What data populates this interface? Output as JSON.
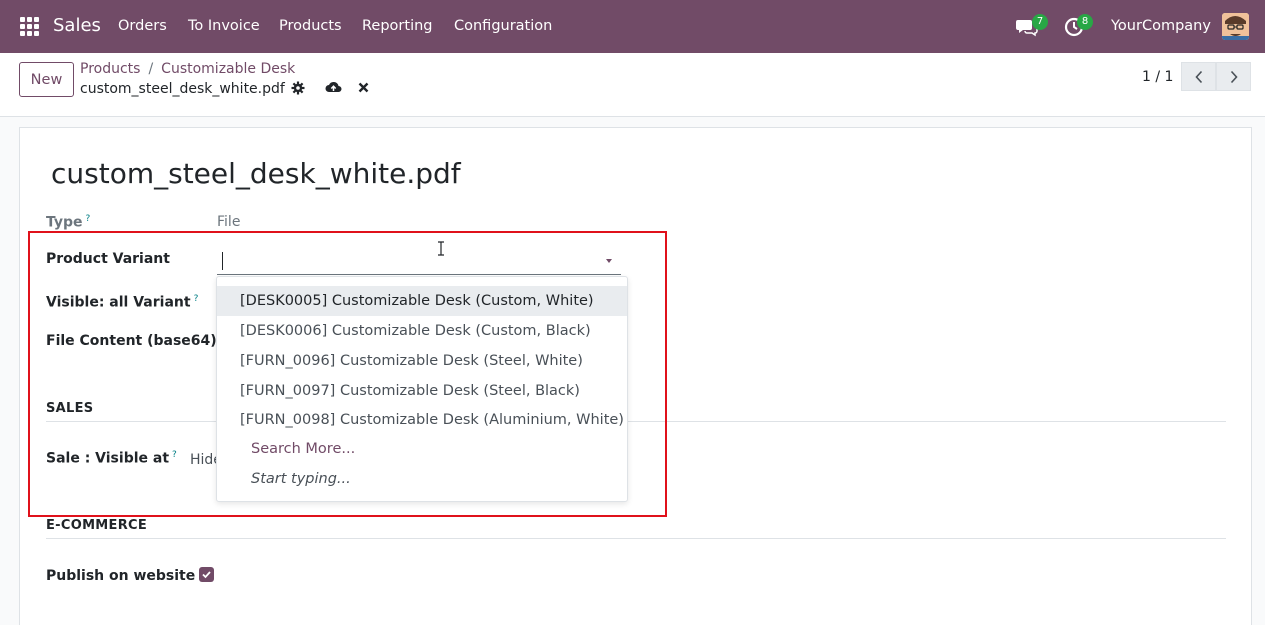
{
  "navbar": {
    "app_name": "Sales",
    "menu": [
      "Orders",
      "To Invoice",
      "Products",
      "Reporting",
      "Configuration"
    ],
    "messages_count": "7",
    "activities_count": "8",
    "company": "YourCompany",
    "color": "#714b67"
  },
  "control_panel": {
    "new_label": "New",
    "breadcrumb": [
      "Products",
      "Customizable Desk"
    ],
    "breadcrumb_sep": "/",
    "record_name": "custom_steel_desk_white.pdf",
    "pager": "1 / 1"
  },
  "form": {
    "title": "custom_steel_desk_white.pdf",
    "type_label": "Type",
    "type_value": "File",
    "help_mark": "?",
    "product_variant_label": "Product Variant",
    "product_variant_value": "",
    "visible_all_variant_label": "Visible: all Variant",
    "file_content_label": "File Content (base64)",
    "sales_section": "SALES",
    "sale_visible_label": "Sale : Visible at",
    "sale_visible_value": "Hide",
    "ecommerce_section": "E-COMMERCE",
    "publish_label": "Publish on website",
    "publish_checked": true
  },
  "dropdown": {
    "items": [
      "[DESK0005] Customizable Desk (Custom, White)",
      "[DESK0006] Customizable Desk (Custom, Black)",
      "[FURN_0096] Customizable Desk (Steel, White)",
      "[FURN_0097] Customizable Desk (Steel, Black)",
      "[FURN_0098] Customizable Desk (Aluminium, White)"
    ],
    "search_more": "Search More...",
    "start_typing": "Start typing..."
  }
}
